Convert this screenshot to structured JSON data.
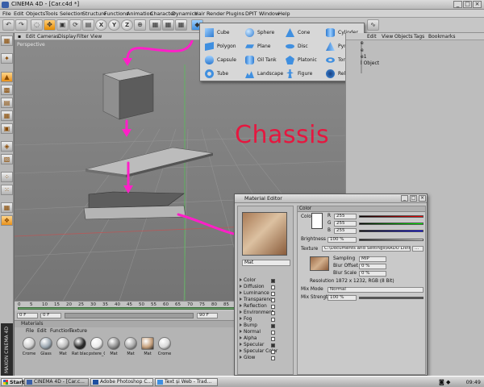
{
  "window": {
    "title": "CINEMA 4D - [Car.c4d *]",
    "min": "_",
    "max": "□",
    "close": "×"
  },
  "menubar": [
    "File",
    "Edit",
    "Objects",
    "Tools",
    "Selection",
    "Structure",
    "Functions",
    "Animation",
    "Character",
    "Dynamics",
    "Hair",
    "Render",
    "Plugins",
    "DPIT",
    "Window",
    "Help"
  ],
  "toolbar": {
    "axis_x": "X",
    "axis_y": "Y",
    "axis_z": "Z"
  },
  "viewport": {
    "menu": [
      "Edit",
      "Cameras",
      "Display",
      "Filter",
      "View"
    ],
    "label": "Perspective"
  },
  "shapes_menu": [
    {
      "label": "Cube",
      "icon": "cube-icon"
    },
    {
      "label": "Polygon",
      "icon": "polygon-icon"
    },
    {
      "label": "Capsule",
      "icon": "capsule-icon"
    },
    {
      "label": "Tube",
      "icon": "tube-icon"
    },
    {
      "label": "Sphere",
      "icon": "sphere-icon"
    },
    {
      "label": "Plane",
      "icon": "plane-icon"
    },
    {
      "label": "Oil Tank",
      "icon": "oil-tank-icon"
    },
    {
      "label": "Landscape",
      "icon": "landscape-icon"
    },
    {
      "label": "Cone",
      "icon": "cone-icon"
    },
    {
      "label": "Disc",
      "icon": "disc-icon"
    },
    {
      "label": "Platonic",
      "icon": "platonic-icon"
    },
    {
      "label": "Figure",
      "icon": "figure-icon"
    },
    {
      "label": "Cylinder",
      "icon": "cylinder-icon"
    },
    {
      "label": "Pyramid",
      "icon": "pyramid-icon"
    },
    {
      "label": "Torus",
      "icon": "torus-icon"
    },
    {
      "label": "Relief",
      "icon": "relief-icon"
    }
  ],
  "object_manager": {
    "menu": [
      "Edit",
      "View",
      "Objects",
      "Tags",
      "Bookmarks"
    ],
    "rows": [
      "e",
      "e",
      "e1",
      "l Object"
    ]
  },
  "overlay_text": "Chassis",
  "timeline": {
    "ticks": [
      "0",
      "5",
      "10",
      "15",
      "20",
      "25",
      "30",
      "35",
      "40",
      "45",
      "50",
      "55",
      "60",
      "65",
      "70",
      "75",
      "80",
      "85",
      "90"
    ],
    "frame_start": "0 F",
    "frame_end": "90 F",
    "current": "0 F"
  },
  "materials": {
    "header": "Materials",
    "menu": [
      "File",
      "Edit",
      "Function",
      "Texture"
    ],
    "items": [
      {
        "label": "Crome",
        "color": "#cfcfcf"
      },
      {
        "label": "Glass",
        "color": "#9aa6b0"
      },
      {
        "label": "Mat",
        "color": "#bdbdbd"
      },
      {
        "label": "Rat black",
        "color": "#2a2a2a"
      },
      {
        "label": "pstere_Gl",
        "color": "#eaeaea"
      },
      {
        "label": "Mat",
        "color": "#8d8d8d"
      },
      {
        "label": "Mat",
        "color": "#a7a7a7"
      },
      {
        "label": "Mat",
        "color": "#c8a27e"
      },
      {
        "label": "Crome",
        "color": "#d8d8d8"
      }
    ]
  },
  "material_editor": {
    "title": "Material Editor",
    "name": "Mat",
    "channels": [
      {
        "label": "Color",
        "on": true
      },
      {
        "label": "Diffusion",
        "on": false
      },
      {
        "label": "Luminance",
        "on": false
      },
      {
        "label": "Transparency",
        "on": false
      },
      {
        "label": "Reflection",
        "on": false
      },
      {
        "label": "Environment",
        "on": false
      },
      {
        "label": "Fog",
        "on": false
      },
      {
        "label": "Bump",
        "on": true
      },
      {
        "label": "Normal",
        "on": false
      },
      {
        "label": "Alpha",
        "on": false
      },
      {
        "label": "Specular",
        "on": true
      },
      {
        "label": "Specular Color",
        "on": false
      },
      {
        "label": "Glow",
        "on": false
      }
    ],
    "section": "Color",
    "color_label": "Color",
    "r_label": "R",
    "g_label": "G",
    "b_label": "B",
    "r_value": "255",
    "g_value": "255",
    "b_value": "255",
    "brightness_label": "Brightness",
    "brightness_value": "100 %",
    "texture_label": "Texture",
    "texture_path": "C:\\Documents and Settings\\RADU LIVIU\\...",
    "sampling_label": "Sampling",
    "sampling_value": "MIP",
    "blur_offset_label": "Blur Offset",
    "blur_offset_value": "0 %",
    "blur_scale_label": "Blur Scale",
    "blur_scale_value": "0 %",
    "resolution": "Resolution 1872 x 1232, RGB (8 Bit)",
    "mix_mode_label": "Mix Mode",
    "mix_mode_value": "Normal",
    "mix_strength_label": "Mix Strength",
    "mix_strength_value": "100 %"
  },
  "taskbar": {
    "start": "Start",
    "tasks": [
      "CINEMA 4D - [Car.c...",
      "Adobe Photoshop C...",
      "Text și Web - Trad..."
    ],
    "clock": "09:49"
  },
  "colors": {
    "annotation_pink": "#ff1fc8",
    "chassis_red": "#e5173f"
  }
}
